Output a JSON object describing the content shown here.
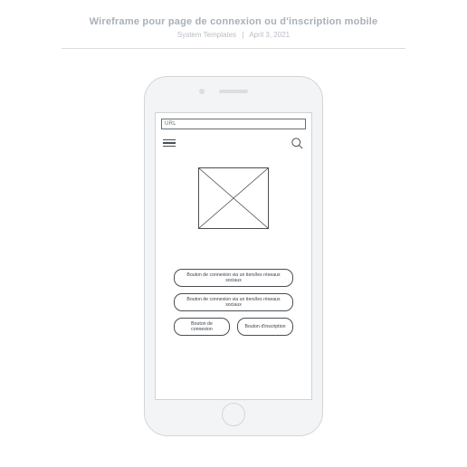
{
  "header": {
    "title": "Wireframe pour page de connexion ou d'inscription mobile",
    "meta_author": "System Templates",
    "meta_date": "April 3, 2021"
  },
  "urlbar": {
    "label": "URL"
  },
  "image_placeholder": {
    "alt": "image-placeholder"
  },
  "buttons": {
    "social1": "Bouton de connexion via un tiers/les réseaux sociaux",
    "social2": "Bouton de connexion via un tiers/les réseaux sociaux",
    "login": "Bouton de connexion",
    "signup": "Bouton d'inscription"
  }
}
